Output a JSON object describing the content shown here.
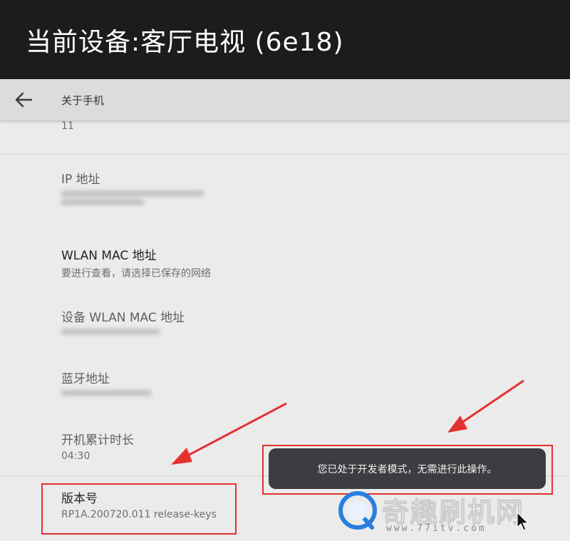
{
  "topbar": {
    "title": "当前设备:客厅电视 (6e18)"
  },
  "appbar": {
    "heading": "关于手机",
    "back_icon": "arrow-left-icon"
  },
  "rows": {
    "android_version_value": "11",
    "ip_label": "IP 地址",
    "wlan_mac_label": "WLAN MAC 地址",
    "wlan_mac_value": "要进行查看，请选择已保存的网络",
    "device_wlan_mac_label": "设备 WLAN MAC 地址",
    "bluetooth_label": "蓝牙地址",
    "uptime_label": "开机累计时长",
    "uptime_value": "04:30",
    "build_label": "版本号",
    "build_value": "RP1A.200720.011 release-keys"
  },
  "toast": {
    "message": "您已处于开发者模式，无需进行此操作。"
  },
  "watermark": {
    "brand": "奇趣刷机网",
    "url": "www.77itv.com"
  },
  "colors": {
    "topbar_bg": "#1c1c1e",
    "appbar_bg": "#dcdcdc",
    "content_bg": "#ebebeb",
    "toast_bg": "#3b3d40",
    "annotation_red": "#e53030"
  }
}
